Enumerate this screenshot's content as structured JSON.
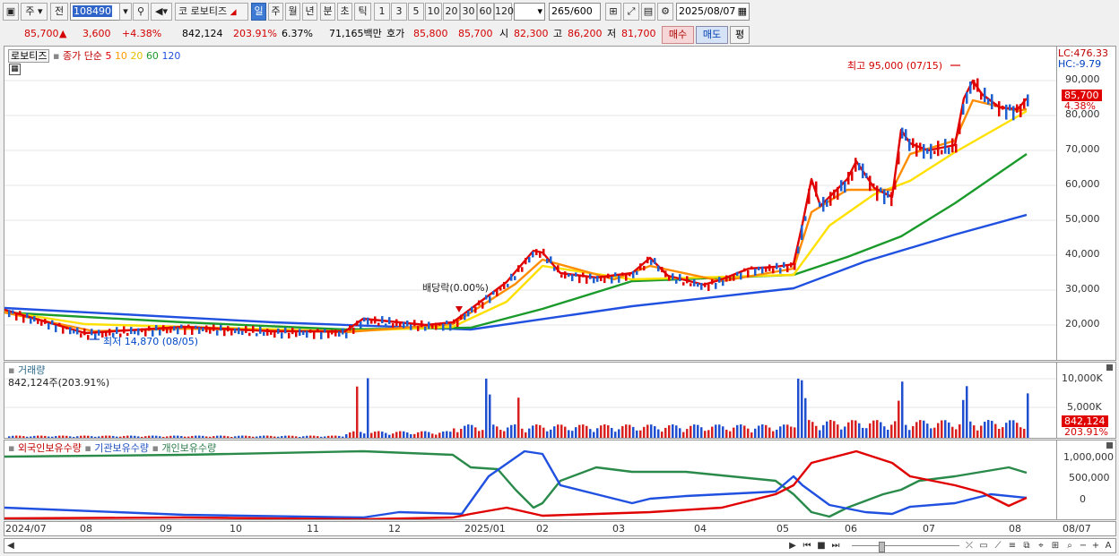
{
  "toolbar": {
    "market_label": "주",
    "prev_label": "전",
    "code": "108490",
    "stock_name": "로보티즈",
    "name_prefix": "코",
    "periods": [
      "일",
      "주",
      "월",
      "년",
      "분",
      "초",
      "틱"
    ],
    "active_period": "일",
    "intervals": [
      "1",
      "3",
      "5",
      "10",
      "20",
      "30",
      "60",
      "120"
    ],
    "count_value": "265",
    "count_total": "/600",
    "date": "2025/08/07"
  },
  "quote": {
    "price": "85,700",
    "price_arrow": "▲",
    "change": "3,600",
    "change_pct": "+4.38%",
    "volume": "842,124",
    "volume_ratio": "203.91%",
    "turnover_pct": "6.37%",
    "amount": "71,165백만",
    "ask_label": "호가",
    "ask": "85,800",
    "bid": "85,700",
    "open_label": "시",
    "open": "82,300",
    "high_label": "고",
    "high": "86,200",
    "low_label": "저",
    "low": "81,700",
    "buy_label": "매수",
    "sell_label": "매도",
    "eval_label": "평"
  },
  "price_panel": {
    "name_box": "로보티즈",
    "legend_close": "종가 단순",
    "ma_labels": [
      "5",
      "10",
      "20",
      "60",
      "120"
    ],
    "ma_colors": [
      "#e00000",
      "#ff9a00",
      "#ffd800",
      "#1a9a2a",
      "#2050e0"
    ],
    "yaxis_header": [
      "LC:476.33",
      "HC:-9.79"
    ],
    "ylabels": [
      "90,000",
      "80,000",
      "70,000",
      "60,000",
      "50,000",
      "40,000",
      "30,000",
      "20,000"
    ],
    "current_price_tag": "85,700",
    "current_pct": "4.38%",
    "high_annotation": "최고 95,000 (07/15)",
    "low_annotation": "최저 14,870 (08/05)",
    "dividend_annotation": "배당락(0.00%)"
  },
  "volume_panel": {
    "title": "거래량",
    "value": "842,124주(203.91%)",
    "ylabels": [
      "10,000K",
      "5,000K"
    ],
    "tag_value": "842,124",
    "tag_pct": "203.91%"
  },
  "holdings_panel": {
    "legend": [
      "외국인보유수량",
      "기관보유수량",
      "개인보유수량"
    ],
    "colors": [
      "#e00000",
      "#2050e0",
      "#2a8a4a"
    ],
    "ylabels": [
      "1,000,000",
      "500,000",
      "0"
    ]
  },
  "xaxis": {
    "labels": [
      "2024/07",
      "08",
      "09",
      "10",
      "11",
      "12",
      "2025/01",
      "02",
      "03",
      "04",
      "05",
      "06",
      "07",
      "08"
    ],
    "right_label": "08/07"
  }
}
